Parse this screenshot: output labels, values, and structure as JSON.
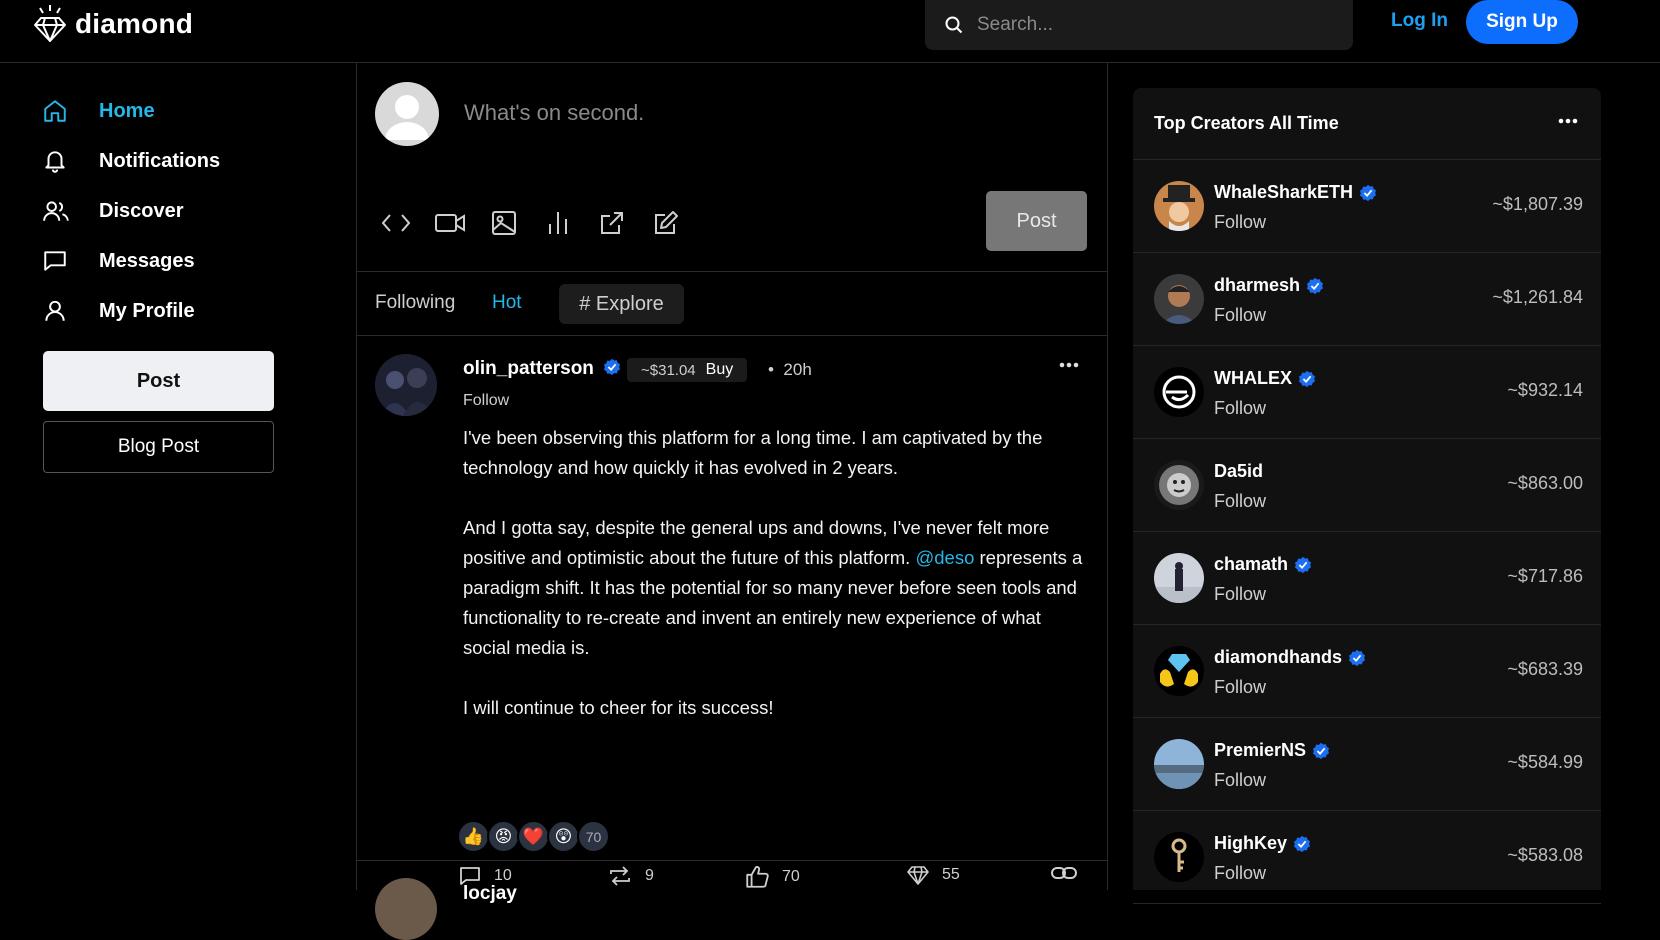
{
  "app": {
    "name": "diamond"
  },
  "search": {
    "placeholder": "Search..."
  },
  "auth": {
    "login": "Log In",
    "signup": "Sign Up"
  },
  "sidebar": {
    "items": [
      {
        "label": "Home",
        "icon": "home-icon",
        "active": true
      },
      {
        "label": "Notifications",
        "icon": "bell-icon"
      },
      {
        "label": "Discover",
        "icon": "users-icon"
      },
      {
        "label": "Messages",
        "icon": "message-icon"
      },
      {
        "label": "My Profile",
        "icon": "user-icon"
      }
    ],
    "post_button": "Post",
    "blog_button": "Blog Post"
  },
  "composer": {
    "placeholder": "What's on second.",
    "post_button": "Post",
    "tools": [
      "code-icon",
      "video-icon",
      "image-icon",
      "poll-icon",
      "external-link-icon",
      "edit-icon"
    ]
  },
  "feed_tabs": {
    "following": "Following",
    "hot": "Hot",
    "explore": "# Explore"
  },
  "post": {
    "username": "olin_patterson",
    "coin_price": "~$31.04",
    "buy": "Buy",
    "separator": "•",
    "time": "20h",
    "follow": "Follow",
    "paragraphs": [
      "I've been observing this platform for a long time. I am captivated by the technology and how quickly it has evolved in 2 years.",
      "And I gotta say, despite the general ups and downs, I've never felt more positive and optimistic about the future of this platform.",
      "represents a paradigm shift. It has the potential for so many never before seen tools and functionality to re-create and invent an entirely new experience of what social media is.",
      "I will continue to cheer for its success!"
    ],
    "mention": "@deso",
    "reactions": [
      "👍",
      "😡",
      "❤️",
      "😲"
    ],
    "reaction_count": "70",
    "comments": "10",
    "reposts": "9",
    "likes": "70",
    "diamonds": "55"
  },
  "next_post": {
    "username": "locjay"
  },
  "right_panel": {
    "title": "Top Creators All Time",
    "creators": [
      {
        "name": "WhaleSharkETH",
        "verified": true,
        "follow": "Follow",
        "value": "~$1,807.39"
      },
      {
        "name": "dharmesh",
        "verified": true,
        "follow": "Follow",
        "value": "~$1,261.84"
      },
      {
        "name": "WHALEX",
        "verified": true,
        "follow": "Follow",
        "value": "~$932.14"
      },
      {
        "name": "Da5id",
        "verified": false,
        "follow": "Follow",
        "value": "~$863.00"
      },
      {
        "name": "chamath",
        "verified": true,
        "follow": "Follow",
        "value": "~$717.86"
      },
      {
        "name": "diamondhands",
        "verified": true,
        "follow": "Follow",
        "value": "~$683.39"
      },
      {
        "name": "PremierNS",
        "verified": true,
        "follow": "Follow",
        "value": "~$584.99"
      },
      {
        "name": "HighKey",
        "verified": true,
        "follow": "Follow",
        "value": "~$583.08"
      }
    ]
  },
  "colors": {
    "accent": "#25b7e8",
    "brand_blue": "#0d6efd",
    "verified": "#1d6ff2"
  }
}
